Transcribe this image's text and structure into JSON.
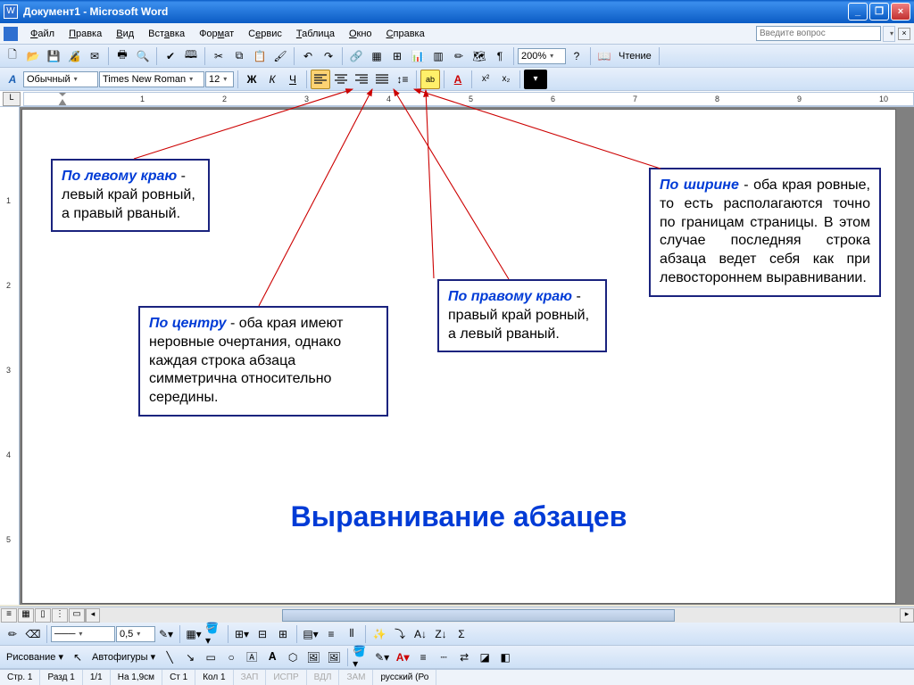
{
  "title": "Документ1 - Microsoft Word",
  "menus": [
    "Файл",
    "Правка",
    "Вид",
    "Вставка",
    "Формат",
    "Сервис",
    "Таблица",
    "Окно",
    "Справка"
  ],
  "help_placeholder": "Введите вопрос",
  "zoom": "200%",
  "read_label": "Чтение",
  "fmt": {
    "style": "Обычный",
    "font": "Times New Roman",
    "size": "12",
    "aa": "A"
  },
  "ruler_nums": [
    "1",
    "2",
    "3",
    "4",
    "5",
    "6",
    "7",
    "8",
    "9",
    "10"
  ],
  "vruler_nums": [
    "1",
    "2",
    "3",
    "4",
    "5"
  ],
  "callouts": {
    "c1": {
      "head": "По левому краю",
      "text": " - левый край ровный, а правый рваный."
    },
    "c2": {
      "head": "По центру",
      "text": " - оба края имеют неровные очертания, однако каждая строка абзаца симметрична относительно середины."
    },
    "c3": {
      "head": "По правому краю",
      "text": " - правый край ровный, а левый рваный."
    },
    "c4": {
      "head": "По ширине",
      "text": " - оба края ровные, то есть располагаются точно по границам страницы. В этом случае последняя строка абзаца ведет себя как при левостороннем выравнивании."
    }
  },
  "main_title": "Выравнивание абзацев",
  "drawing": {
    "label": "Рисование",
    "autoshapes": "Автофигуры"
  },
  "status": {
    "page": "Стр. 1",
    "section": "Разд 1",
    "pages": "1/1",
    "at": "На 1,9см",
    "line": "Ст 1",
    "col": "Кол 1",
    "rec": "ЗАП",
    "trk": "ИСПР",
    "ext": "ВДЛ",
    "ovr": "ЗАМ",
    "lang": "русский (Ро"
  },
  "line_width": "0,5"
}
